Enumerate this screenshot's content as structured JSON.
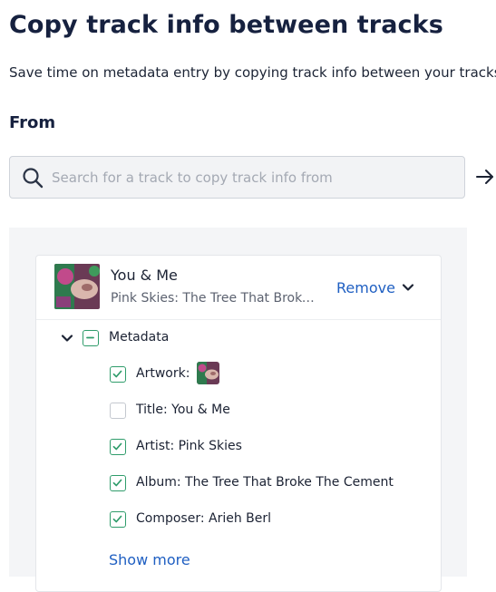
{
  "heading": "Copy track info between tracks",
  "subtitle": "Save time on metadata entry by copying track info between your tracks",
  "from_label": "From",
  "search": {
    "placeholder": "Search for a track to copy track info from",
    "value": ""
  },
  "track": {
    "title": "You & Me",
    "subtitle": "Pink Skies: The Tree That Broke The Cement",
    "remove_label": "Remove"
  },
  "metadata": {
    "label": "Metadata",
    "items": [
      {
        "label": "Artwork:",
        "checked": true
      },
      {
        "label": "Title: You & Me",
        "checked": false
      },
      {
        "label": "Artist: Pink Skies",
        "checked": true
      },
      {
        "label": "Album: The Tree That Broke The Cement",
        "checked": true
      },
      {
        "label": "Composer: Arieh Berl",
        "checked": true
      }
    ],
    "show_more_label": "Show more"
  },
  "colors": {
    "accent_link": "#1f5fc2",
    "check_green": "#2f9c6b",
    "heading": "#16213f"
  },
  "icons": [
    "search-icon",
    "arrow-right-icon",
    "chevron-down-icon",
    "indeterminate-checkbox-icon",
    "checkmark-icon",
    "album-artwork"
  ]
}
